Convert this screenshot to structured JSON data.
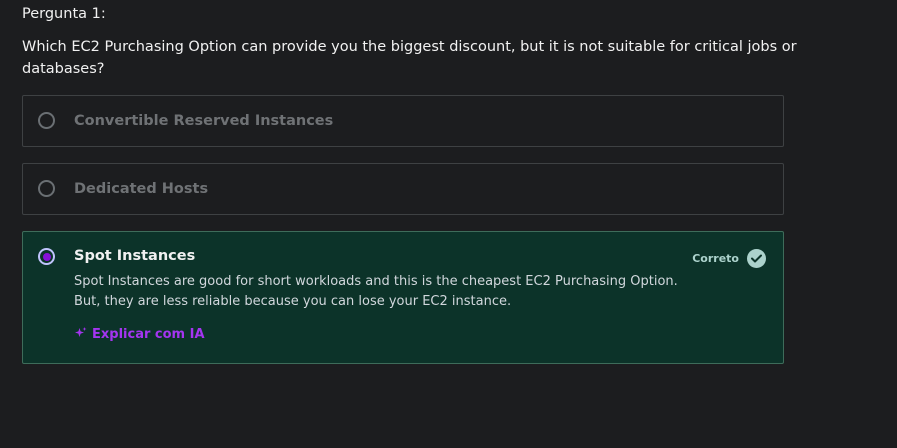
{
  "question": {
    "label": "Pergunta 1:",
    "text": "Which EC2 Purchasing Option can provide you the biggest discount, but it is not suitable for critical jobs or databases?"
  },
  "options": [
    {
      "label": "Convertible Reserved Instances",
      "selected": false
    },
    {
      "label": "Dedicated Hosts",
      "selected": false
    },
    {
      "label": "Spot Instances",
      "selected": true,
      "verdict": "Correto",
      "explanation_line1": "Spot Instances are good for short workloads and this is the cheapest EC2 Purchasing Option.",
      "explanation_line2": "But, they are less reliable because you can lose your EC2 instance.",
      "ai_link": "Explicar com IA"
    }
  ],
  "colors": {
    "background": "#1c1d1f",
    "correct_background": "#0c3329",
    "correct_accent": "#acd2cc",
    "brand_purple": "#a435f0"
  },
  "icons": {
    "verdict": "check-circle-icon",
    "ai": "sparkle-icon"
  }
}
